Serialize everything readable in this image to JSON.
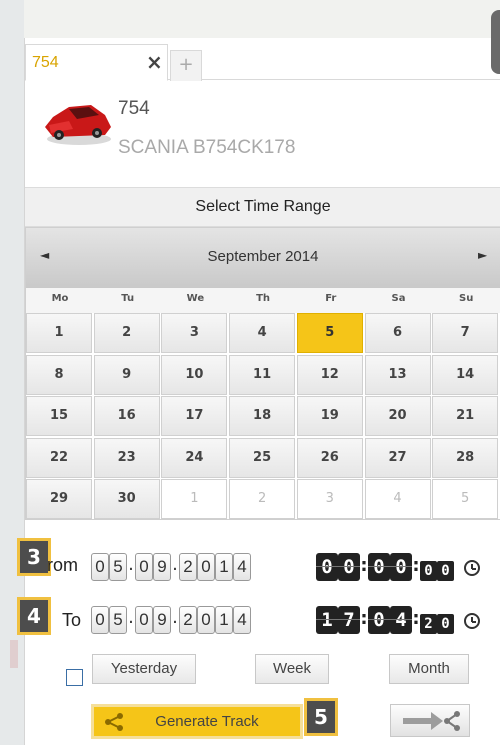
{
  "tab": {
    "title": "754",
    "close": "×",
    "add": "+"
  },
  "vehicle": {
    "id": "754",
    "model": "SCANIA B754CK178"
  },
  "time_range": {
    "title": "Select Time Range"
  },
  "calendar": {
    "month_label": "September 2014",
    "prev": "◄",
    "next": "►",
    "weekdays": [
      "Mo",
      "Tu",
      "We",
      "Th",
      "Fr",
      "Sa",
      "Su"
    ],
    "days": [
      [
        "1",
        "2",
        "3",
        "4",
        "5",
        "6",
        "7"
      ],
      [
        "8",
        "9",
        "10",
        "11",
        "12",
        "13",
        "14"
      ],
      [
        "15",
        "16",
        "17",
        "18",
        "19",
        "20",
        "21"
      ],
      [
        "22",
        "23",
        "24",
        "25",
        "26",
        "27",
        "28"
      ],
      [
        "29",
        "30",
        "1",
        "2",
        "3",
        "4",
        "5"
      ]
    ],
    "selected_day": "5",
    "selected_color": "#f5c518"
  },
  "badges": {
    "b3": "3",
    "b4": "4",
    "b5": "5"
  },
  "from": {
    "label": "rom",
    "date": [
      "0",
      "5",
      "0",
      "9",
      "2",
      "0",
      "1",
      "4"
    ],
    "time_h": [
      "0",
      "0"
    ],
    "time_m": [
      "0",
      "0"
    ],
    "time_s": [
      "0",
      "0"
    ]
  },
  "to": {
    "label": "To",
    "date": [
      "0",
      "5",
      "0",
      "9",
      "2",
      "0",
      "1",
      "4"
    ],
    "time_h": [
      "1",
      "7"
    ],
    "time_m": [
      "0",
      "4"
    ],
    "time_s": [
      "2",
      "0"
    ]
  },
  "date_sep": ".",
  "time_sep": ":",
  "quick": {
    "yesterday": "Yesterday",
    "week": "Week",
    "month": "Month"
  },
  "generate": {
    "label": "Generate Track"
  },
  "icons": {
    "close": "close-icon",
    "share": "share-icon",
    "export": "arrow-share-icon",
    "clock": "clock-icon",
    "car": "car-icon"
  },
  "colors": {
    "accent": "#f5c518",
    "tab_title": "#d9a400",
    "badge_bg": "#4d4d4d",
    "badge_border": "#f0c040"
  }
}
